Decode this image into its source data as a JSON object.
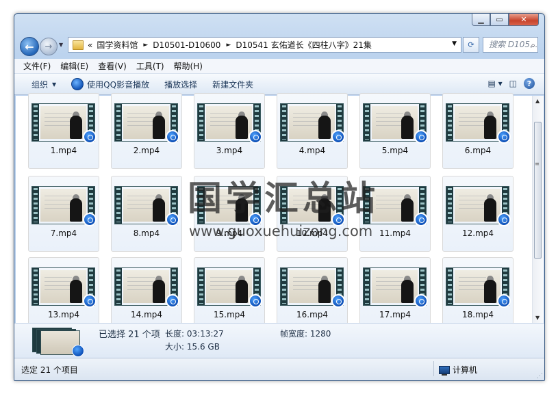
{
  "window": {
    "minimize_icon": "minimize-icon",
    "maximize_icon": "maximize-icon",
    "close_icon": "close-icon"
  },
  "nav": {
    "overflow": "«",
    "path": [
      "国学资料馆",
      "D10501-D10600",
      "D10541 玄佑道长《四柱八字》21集"
    ],
    "search_placeholder": "搜索 D105..."
  },
  "menu": [
    "文件(F)",
    "编辑(E)",
    "查看(V)",
    "工具(T)",
    "帮助(H)"
  ],
  "toolbar": {
    "organize": "组织",
    "play_qq": "使用QQ影音播放",
    "play_selection": "播放选择",
    "new_folder": "新建文件夹"
  },
  "files": [
    "1.mp4",
    "2.mp4",
    "3.mp4",
    "4.mp4",
    "5.mp4",
    "6.mp4",
    "7.mp4",
    "8.mp4",
    "9.mp4",
    "10.mp4",
    "11.mp4",
    "12.mp4",
    "13.mp4",
    "14.mp4",
    "15.mp4",
    "16.mp4",
    "17.mp4",
    "18.mp4"
  ],
  "watermark": {
    "title": "国学汇总站",
    "url": "www.guoxuehuizong.com"
  },
  "details": {
    "selected": "已选择 21 个项",
    "length_label": "长度:",
    "length_value": "03:13:27",
    "size_label": "大小:",
    "size_value": "15.6 GB",
    "frame_width_label": "帧宽度:",
    "frame_width_value": "1280"
  },
  "status": {
    "left": "选定 21 个项目",
    "right": "计算机"
  },
  "colors": {
    "accent": "#1e395b",
    "frame": "#bcd3ee",
    "close": "#c7432b"
  }
}
